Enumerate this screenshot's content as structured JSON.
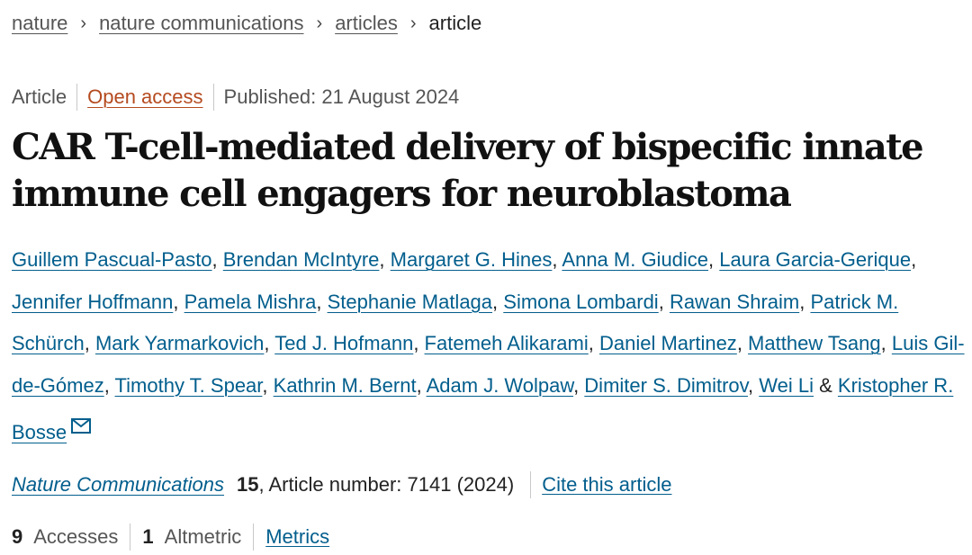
{
  "breadcrumb": {
    "items": [
      "nature",
      "nature communications",
      "articles"
    ],
    "current": "article",
    "separator": "›"
  },
  "meta": {
    "type": "Article",
    "access": "Open access",
    "published": "Published: 21 August 2024"
  },
  "title": "CAR T-cell-mediated delivery of bispecific innate immune cell engagers for neuroblastoma",
  "authors": {
    "names": [
      "Guillem Pascual-Pasto",
      "Brendan McIntyre",
      "Margaret G. Hines",
      "Anna M. Giudice",
      "Laura Garcia-Gerique",
      "Jennifer Hoffmann",
      "Pamela Mishra",
      "Stephanie Matlaga",
      "Simona Lombardi",
      "Rawan Shraim",
      "Patrick M. Schürch",
      "Mark Yarmarkovich",
      "Ted J. Hofmann",
      "Fatemeh Alikarami",
      "Daniel Martinez",
      "Matthew Tsang",
      "Luis Gil-de-Gómez",
      "Timothy T. Spear",
      "Kathrin M. Bernt",
      "Adam J. Wolpaw",
      "Dimiter S. Dimitrov",
      "Wei Li",
      "Kristopher R. Bosse"
    ],
    "conjunction": "&",
    "contact_icon": "mail-icon"
  },
  "citation": {
    "journal": "Nature Communications",
    "volume": "15",
    "article_number": ", Article number: 7141 (2024)",
    "cite_label": "Cite this article"
  },
  "metrics": {
    "accesses_value": "9",
    "accesses_label": "Accesses",
    "altmetric_value": "1",
    "altmetric_label": "Altmetric",
    "metrics_link": "Metrics"
  },
  "colors": {
    "link": "#025e8d",
    "open_access": "#b54a1f",
    "muted_text": "#555555",
    "title_text": "#111111"
  }
}
